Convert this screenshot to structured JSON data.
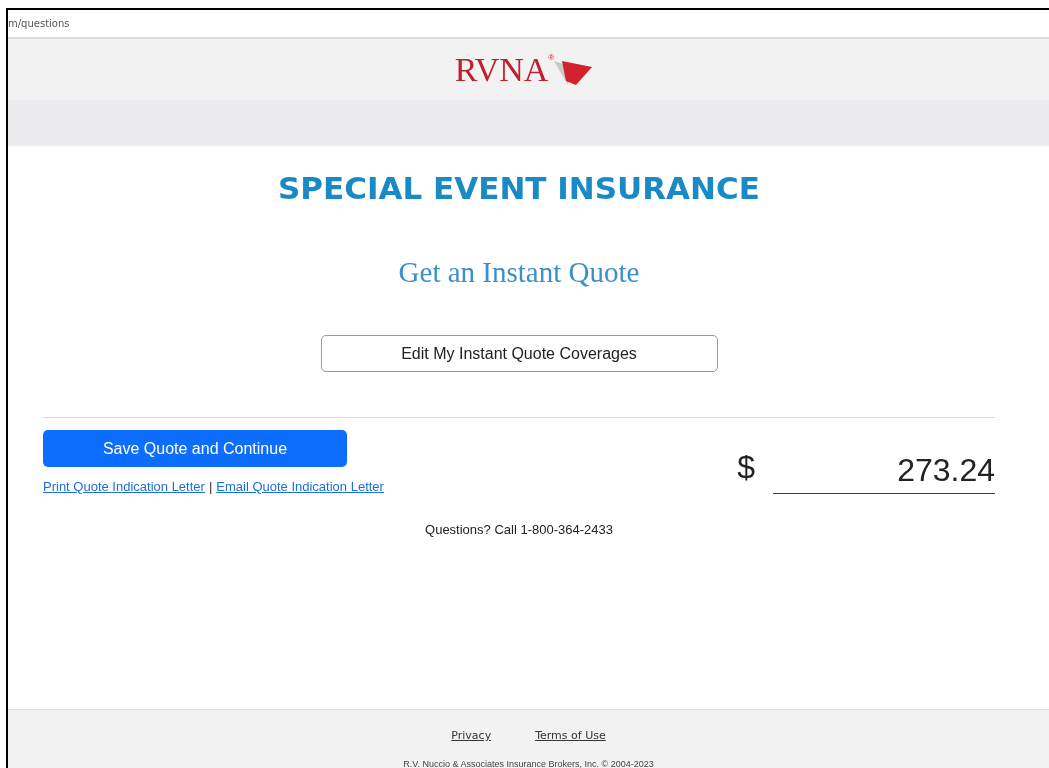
{
  "address_bar": {
    "url": "m/questions"
  },
  "header": {
    "logo": "RVNA",
    "logo_mark": "®"
  },
  "title": "SPECIAL EVENT INSURANCE",
  "subtitle": "Get an Instant Quote",
  "edit_button": "Edit My Instant Quote Coverages",
  "save_button": "Save Quote and Continue",
  "links": [
    "Print Quote Indication Letter",
    "Email Quote Indication Letter"
  ],
  "link_separator": "|",
  "price": {
    "currency": "$",
    "value": "273.24"
  },
  "contact": "Questions? Call 1-800-364-2433",
  "footer": {
    "links": [
      "Privacy",
      "Terms of Use"
    ],
    "copyright": "R.V. Nuccio & Associates Insurance Brokers, Inc. © 2004-2023"
  }
}
